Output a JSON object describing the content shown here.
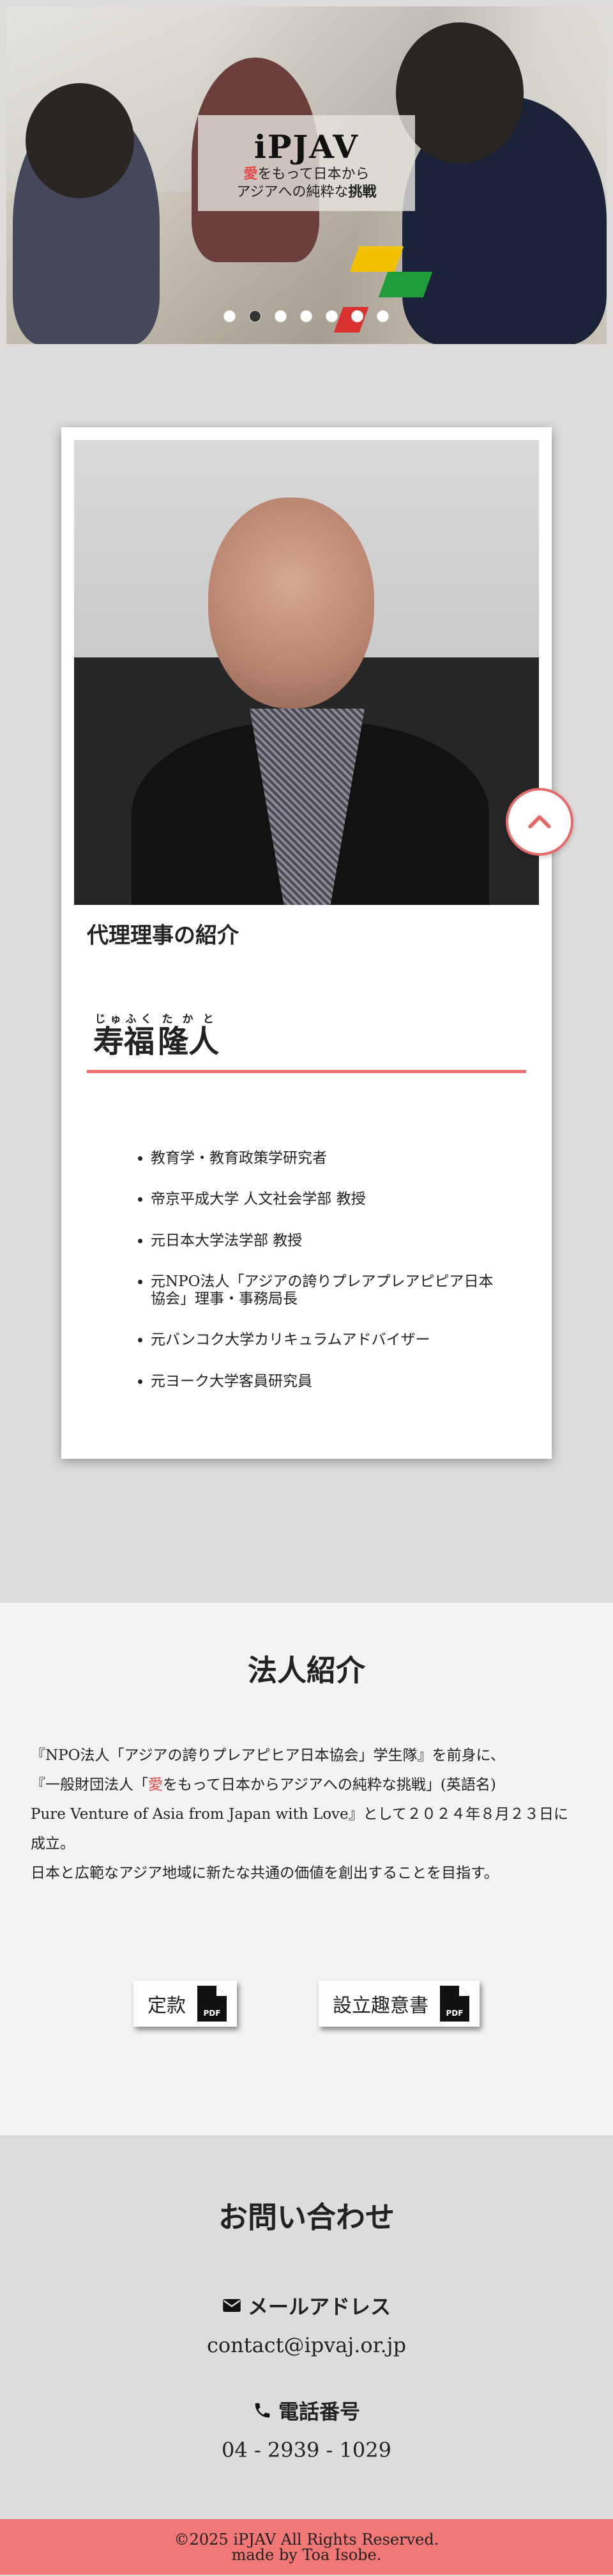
{
  "hero": {
    "title": "iPJAV",
    "subtitle_ai": "愛",
    "subtitle_rest1": "をもって日本から",
    "subtitle_line2": "アジアへの純粋な",
    "subtitle_bold": "挑戦",
    "slide_count": 7,
    "active_slide": 1
  },
  "member": {
    "section_label": "代理理事の紹介",
    "name_family": "寿福",
    "name_family_ruby": "じゅふく",
    "name_given": "隆人",
    "name_given_ruby": "たかと",
    "qualifications": [
      "教育学・教育政策学研究者",
      "帝京平成大学 人文社会学部 教授",
      "元日本大学法学部 教授",
      "元NPO法人「アジアの誇りプレアプレアピピア日本協会」理事・事務局長",
      "元バンコク大学カリキュラムアドバイザー",
      "元ヨーク大学客員研究員"
    ]
  },
  "about": {
    "title": "法人紹介",
    "line1": "『NPO法人「アジアの誇りプレアピヒア日本協会」学生隊』を前身に、",
    "line2_pre": "『一般財団法人「",
    "line2_ai": "愛",
    "line2_post": "をもって日本からアジアへの純粋な挑戦」(英語名)",
    "line3": "Pure Venture of Asia from Japan with Love』として２０２４年８月２３日に成立。",
    "line4": "日本と広範なアジア地域に新たな共通の価値を創出することを目指す。",
    "btn_bylaws": "定款",
    "btn_prospectus": "設立趣意書"
  },
  "contact": {
    "title": "お問い合わせ",
    "email_label": "メールアドレス",
    "email": "contact@ipvaj.or.jp",
    "phone_label": "電話番号",
    "phone": "04 - 2939 - 1029"
  },
  "footer": {
    "copyright": "©2025 iPJAV All Rights Reserved.",
    "credit": "made by Toa Isobe."
  },
  "colors": {
    "accent": "#f27777",
    "ai_red": "#e74c4c"
  },
  "icons": [
    "envelope-icon",
    "phone-icon",
    "pdf-icon",
    "chevron-up-icon"
  ]
}
